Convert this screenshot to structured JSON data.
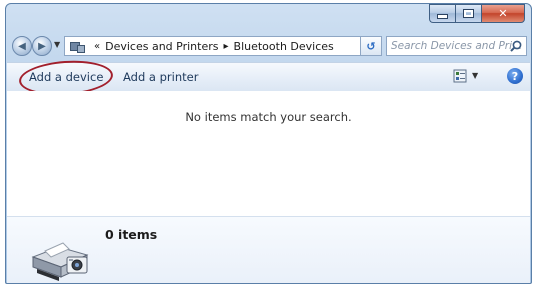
{
  "address": {
    "crumbs": [
      "Devices and Printers",
      "Bluetooth Devices"
    ]
  },
  "search": {
    "placeholder": "Search Devices and Pri..."
  },
  "toolbar": {
    "add_device_label": "Add a device",
    "add_printer_label": "Add a printer"
  },
  "content": {
    "empty_message": "No items match your search."
  },
  "details": {
    "item_count": "0 items"
  },
  "colors": {
    "highlight_oval": "#a21f2c",
    "command_text": "#1e395b"
  }
}
